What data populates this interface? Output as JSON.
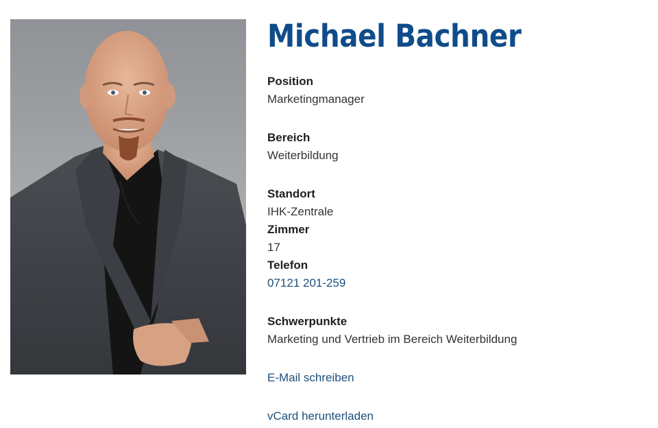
{
  "person": {
    "name": "Michael Bachner"
  },
  "fields": {
    "position": {
      "label": "Position",
      "value": "Marketingmanager"
    },
    "bereich": {
      "label": "Bereich",
      "value": "Weiterbildung"
    },
    "standort": {
      "label": "Standort",
      "value": "IHK-Zentrale"
    },
    "zimmer": {
      "label": "Zimmer",
      "value": "17"
    },
    "telefon": {
      "label": "Telefon",
      "value": "07121 201-259"
    },
    "schwerpunkte": {
      "label": "Schwerpunkte",
      "value": "Marketing und Vertrieb im Bereich Weiterbildung"
    }
  },
  "actions": {
    "email": "E-Mail schreiben",
    "vcard": "vCard herunterladen"
  },
  "colors": {
    "heading": "#0f4c8a",
    "link": "#1c4f7c"
  }
}
